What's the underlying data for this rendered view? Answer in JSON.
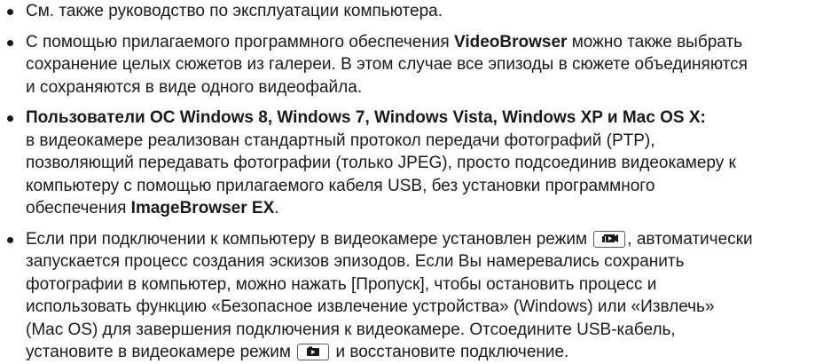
{
  "notes": [
    {
      "lines": [
        [
          "См. также руководство по эксплуатации компьютера."
        ]
      ]
    },
    {
      "lines": [
        [
          "С помощью прилагаемого программного обеспечения ",
          "VideoBrowser",
          " можно также выбрать"
        ],
        [
          "сохранение целых сюжетов из галереи. В этом случае все эпизоды в сюжете объединяются"
        ],
        [
          "и сохраняются в виде одного видеофайла."
        ]
      ]
    },
    {
      "lines": [
        [
          "Пользователи ОС Windows 8, Windows 7, Windows Vista, Windows XP и Mac OS X:"
        ],
        [
          "в видеокамере реализован стандартный протокол передачи фотографий (PTP),"
        ],
        [
          "позволяющий передавать фотографии (только JPEG), просто подсоединив видеокамеру к"
        ],
        [
          "компьютеру с помощью прилагаемого кабеля USB, без установки программного"
        ],
        [
          "обеспечения ",
          "ImageBrowser EX",
          "."
        ]
      ]
    },
    {
      "lines": [
        [
          "Если при подключении к компьютеру в видеокамере установлен режим ",
          ", автоматически"
        ],
        [
          "запускается процесс создания эскизов эпизодов. Если Вы намеревались сохранить"
        ],
        [
          "фотографии в компьютер, можно нажать [Пропуск], чтобы остановить процесс и"
        ],
        [
          "использовать функцию «Безопасное извлечение устройства» (Windows) или «Извлечь»"
        ],
        [
          "(Mac OS) для завершения подключения к видеокамере. Отсоедините USB-кабель,"
        ],
        [
          "установите в видеокамере режим ",
          " и восстановите подключение."
        ]
      ]
    }
  ],
  "icons": {
    "video_mode": "video-playback-mode-icon",
    "photo_mode": "photo-playback-mode-icon"
  }
}
